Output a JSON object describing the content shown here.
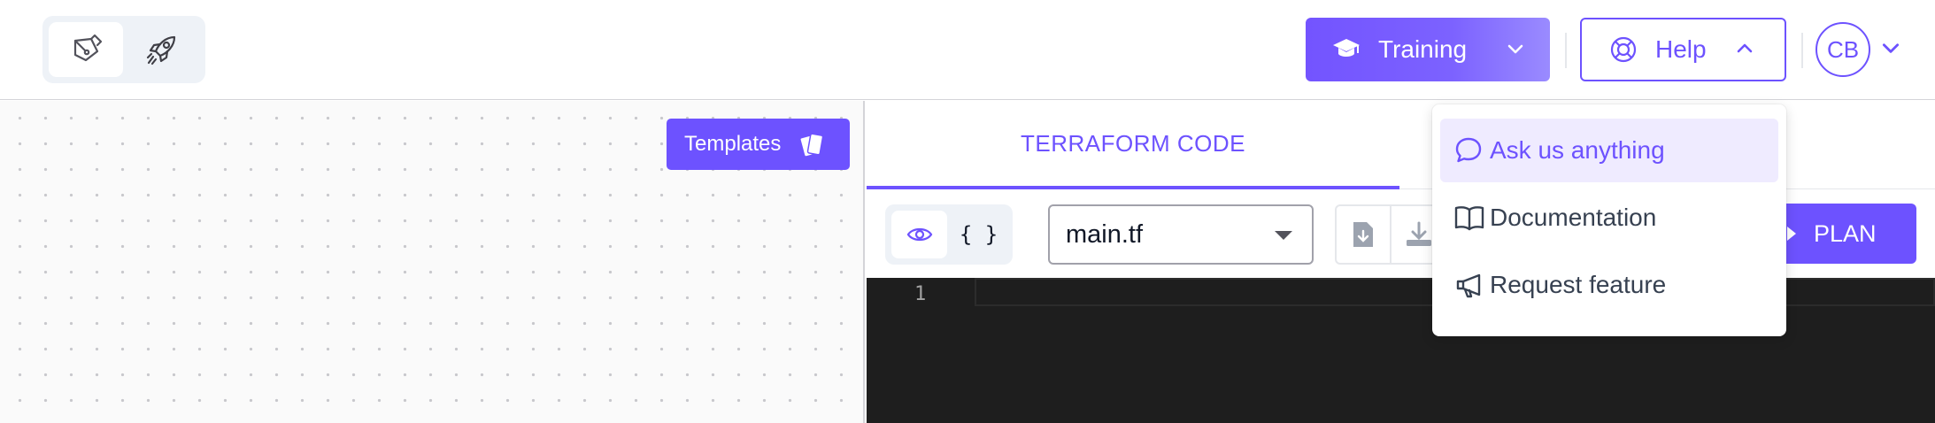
{
  "header": {
    "mode_toggle": {
      "items": [
        {
          "icon": "pen-nib-icon",
          "active": true
        },
        {
          "icon": "rocket-icon",
          "active": false
        }
      ]
    },
    "training_label": "Training",
    "help_label": "Help",
    "avatar_initials": "CB"
  },
  "help_menu": {
    "items": [
      {
        "label": "Ask us anything",
        "icon": "chat-bubble-icon",
        "active": true
      },
      {
        "label": "Documentation",
        "icon": "book-open-icon",
        "active": false
      },
      {
        "label": "Request feature",
        "icon": "megaphone-icon",
        "active": false
      }
    ]
  },
  "canvas": {
    "templates_label": "Templates"
  },
  "panel": {
    "tab_label": "TERRAFORM CODE",
    "view_toggle": {
      "code_label": "{ }"
    },
    "file_select": {
      "value": "main.tf"
    },
    "plan_label": "PLAN",
    "editor": {
      "line_number": "1"
    }
  },
  "colors": {
    "accent": "#6d52ff",
    "editor_bg": "#1e1e1e"
  }
}
